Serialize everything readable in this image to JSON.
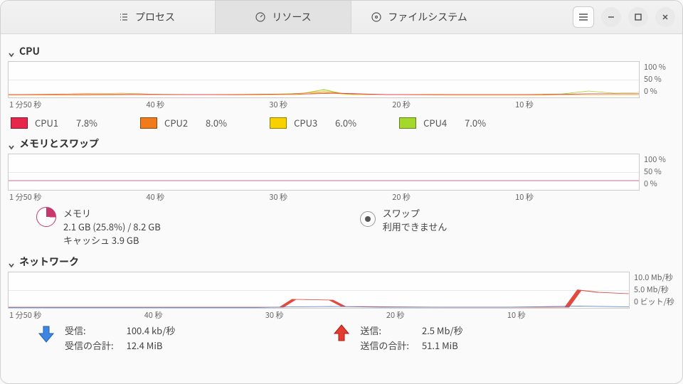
{
  "tabs": {
    "processes": "プロセス",
    "resources": "リソース",
    "filesystem": "ファイルシステム"
  },
  "axis": {
    "x": [
      "1 分",
      "50 秒",
      "40 秒",
      "30 秒",
      "20 秒",
      "10 秒"
    ]
  },
  "cpu": {
    "title": "CPU",
    "y": [
      "100 %",
      "50 %",
      "0 %"
    ],
    "legend": [
      {
        "name": "CPU1",
        "value": "7.8%",
        "color": "#e6264a"
      },
      {
        "name": "CPU2",
        "value": "8.0%",
        "color": "#ef7b1a"
      },
      {
        "name": "CPU3",
        "value": "6.0%",
        "color": "#f7d200"
      },
      {
        "name": "CPU4",
        "value": "7.0%",
        "color": "#a4d92c"
      }
    ]
  },
  "memory": {
    "title": "メモリとスワップ",
    "y": [
      "100 %",
      "50 %",
      "0 %"
    ],
    "mem_label": "メモリ",
    "mem_line": "2.1 GB (25.8%) / 8.2 GB",
    "mem_cache": "キャッシュ 3.9 GB",
    "swap_label": "スワップ",
    "swap_value": "利用できません"
  },
  "network": {
    "title": "ネットワーク",
    "y": [
      "10.0 Mb/秒",
      "5.0 Mb/秒",
      "0 ビット/秒"
    ],
    "recv_label": "受信:",
    "recv_value": "100.4 kb/秒",
    "recv_total_label": "受信の合計:",
    "recv_total_value": "12.4 MiB",
    "send_label": "送信:",
    "send_value": "2.5 Mb/秒",
    "send_total_label": "送信の合計:",
    "send_total_value": "51.1 MiB"
  },
  "chart_data": [
    {
      "type": "line",
      "title": "CPU",
      "xlabel": "",
      "ylabel": "",
      "ylim": [
        0,
        100
      ],
      "x_ticks": [
        "1 分",
        "50 秒",
        "40 秒",
        "30 秒",
        "20 秒",
        "10 秒"
      ],
      "series": [
        {
          "name": "CPU1",
          "color": "#e6264a",
          "values": [
            7,
            7,
            7,
            8,
            8,
            7,
            7,
            8,
            9,
            8,
            7,
            7
          ]
        },
        {
          "name": "CPU2",
          "color": "#ef7b1a",
          "values": [
            8,
            8,
            9,
            8,
            8,
            9,
            14,
            9,
            8,
            8,
            8,
            9
          ]
        },
        {
          "name": "CPU3",
          "color": "#f7d200",
          "values": [
            6,
            6,
            7,
            7,
            8,
            7,
            8,
            7,
            6,
            6,
            7,
            6
          ]
        },
        {
          "name": "CPU4",
          "color": "#a4d92c",
          "values": [
            7,
            7,
            8,
            7,
            7,
            8,
            12,
            8,
            7,
            8,
            12,
            10
          ]
        }
      ]
    },
    {
      "type": "line",
      "title": "メモリとスワップ",
      "xlabel": "",
      "ylabel": "",
      "ylim": [
        0,
        100
      ],
      "x_ticks": [
        "1 分",
        "50 秒",
        "40 秒",
        "30 秒",
        "20 秒",
        "10 秒"
      ],
      "series": [
        {
          "name": "メモリ",
          "color": "#c9386a",
          "values": [
            26,
            26,
            26,
            26,
            26,
            26,
            26,
            26,
            26,
            26,
            26,
            26
          ]
        }
      ]
    },
    {
      "type": "line",
      "title": "ネットワーク",
      "xlabel": "",
      "ylabel": "Mb/秒",
      "ylim": [
        0,
        10
      ],
      "x_ticks": [
        "1 分",
        "50 秒",
        "40 秒",
        "30 秒",
        "20 秒",
        "10 秒"
      ],
      "series": [
        {
          "name": "送信",
          "color": "#e04a3f",
          "values": [
            0,
            0,
            0,
            0,
            0,
            2.2,
            2.2,
            0.2,
            0.2,
            0.2,
            0.2,
            5.0,
            4.0
          ]
        },
        {
          "name": "受信",
          "color": "#4f77c7",
          "values": [
            0,
            0,
            0,
            0,
            0,
            0.1,
            0.2,
            0.1,
            0.1,
            0.1,
            0.1,
            0.3,
            0.2
          ]
        }
      ]
    }
  ]
}
